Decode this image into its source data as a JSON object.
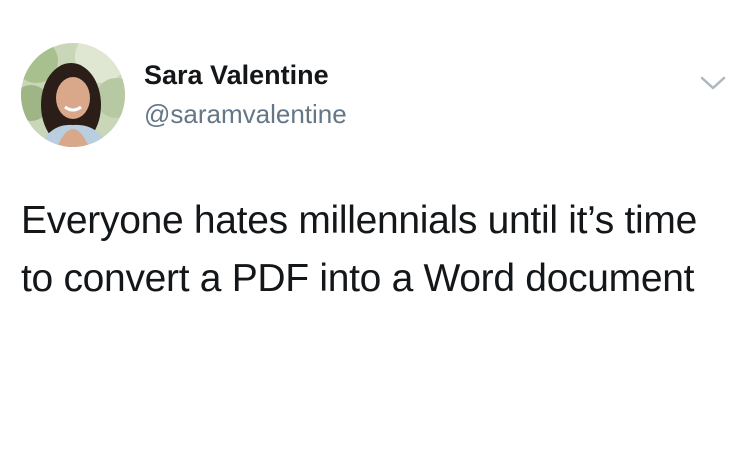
{
  "tweet": {
    "author": {
      "display_name": "Sara Valentine",
      "handle": "@saramvalentine"
    },
    "text": "Everyone hates millennials until it’s time to convert a PDF into a Word document"
  },
  "icons": {
    "menu": "chevron-down-icon"
  },
  "colors": {
    "name_text": "#14171a",
    "handle_text": "#657786",
    "caret": "#aab8c2",
    "background": "#ffffff"
  }
}
